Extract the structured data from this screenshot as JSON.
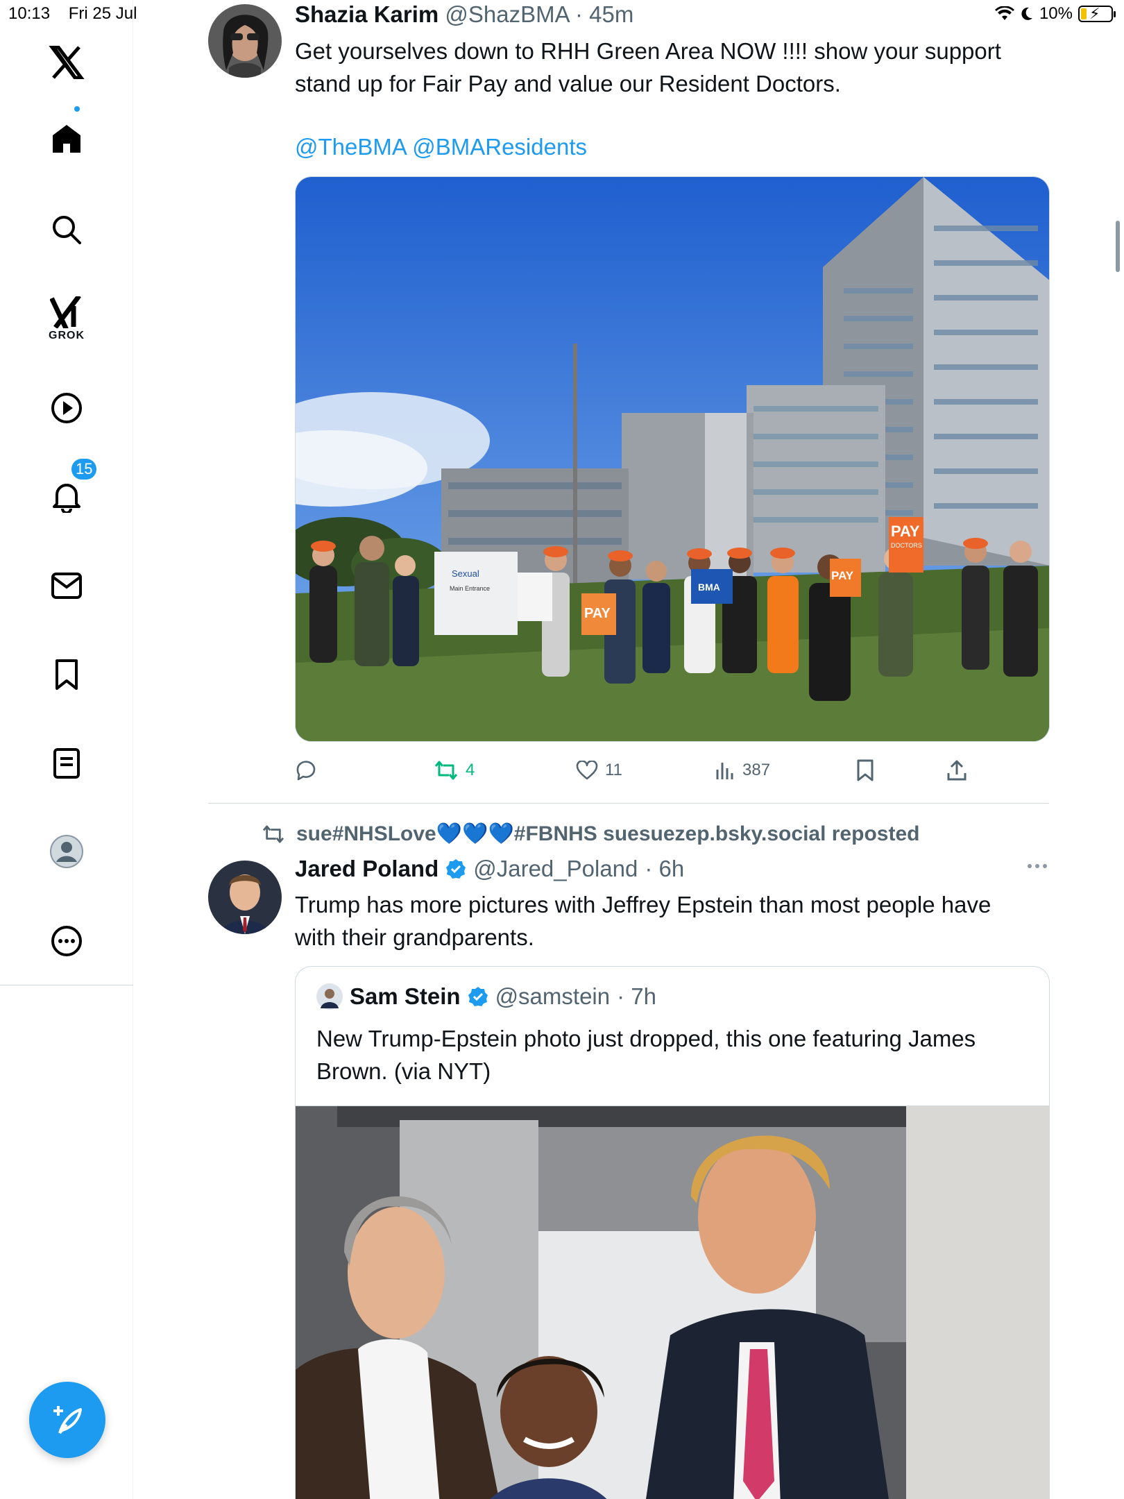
{
  "status_bar": {
    "time": "10:13",
    "date": "Fri 25 Jul",
    "battery": "10%"
  },
  "sidebar": {
    "logo": "x-logo-icon",
    "items": [
      {
        "name": "home",
        "icon": "home-icon"
      },
      {
        "name": "explore",
        "icon": "search-icon"
      },
      {
        "name": "grok",
        "icon": "grok-icon",
        "label": "GROK"
      },
      {
        "name": "video",
        "icon": "play-icon"
      },
      {
        "name": "notifications",
        "icon": "bell-icon",
        "badge": "15"
      },
      {
        "name": "messages",
        "icon": "mail-icon"
      },
      {
        "name": "bookmarks",
        "icon": "bookmark-icon"
      },
      {
        "name": "lists",
        "icon": "list-icon"
      },
      {
        "name": "profile",
        "icon": "profile-icon"
      },
      {
        "name": "more",
        "icon": "more-icon"
      }
    ],
    "compose_icon": "compose-icon"
  },
  "tweet1": {
    "author": "Shazia Karim",
    "handle": "@ShazBMA",
    "time": "· 45m",
    "text_line1": "Get yourselves down to RHH Green Area NOW !!!! show your support",
    "text_line2": "stand up for Fair Pay and value our Resident Doctors.",
    "mention1": "@TheBMA",
    "mention2": "@BMAResidents",
    "image_signs": {
      "pay_sign": "PAY",
      "doctors_sign": "DOCTORS",
      "bma": "BMA",
      "sexual": "Sexual",
      "main_entrance": "Main Entrance"
    },
    "stats": {
      "retweets": "4",
      "likes": "11",
      "views": "387"
    }
  },
  "repost_banner": "sue#NHSLove💙💙💙#FBNHS suesuezep.bsky.social reposted",
  "tweet2": {
    "author": "Jared Poland",
    "handle": "@Jared_Poland",
    "time": "· 6h",
    "text_line1": "Trump has more pictures with Jeffrey Epstein than most people have",
    "text_line2": "with their grandparents.",
    "quote": {
      "author": "Sam Stein",
      "handle": "@samstein",
      "time": "· 7h",
      "text_line1": "New Trump-Epstein photo just dropped, this one featuring James",
      "text_line2": "Brown. (via NYT)"
    }
  },
  "colors": {
    "accent": "#1d9bf0",
    "retweet": "#00ba7c",
    "muted": "#536471",
    "border": "#cfd9de"
  }
}
